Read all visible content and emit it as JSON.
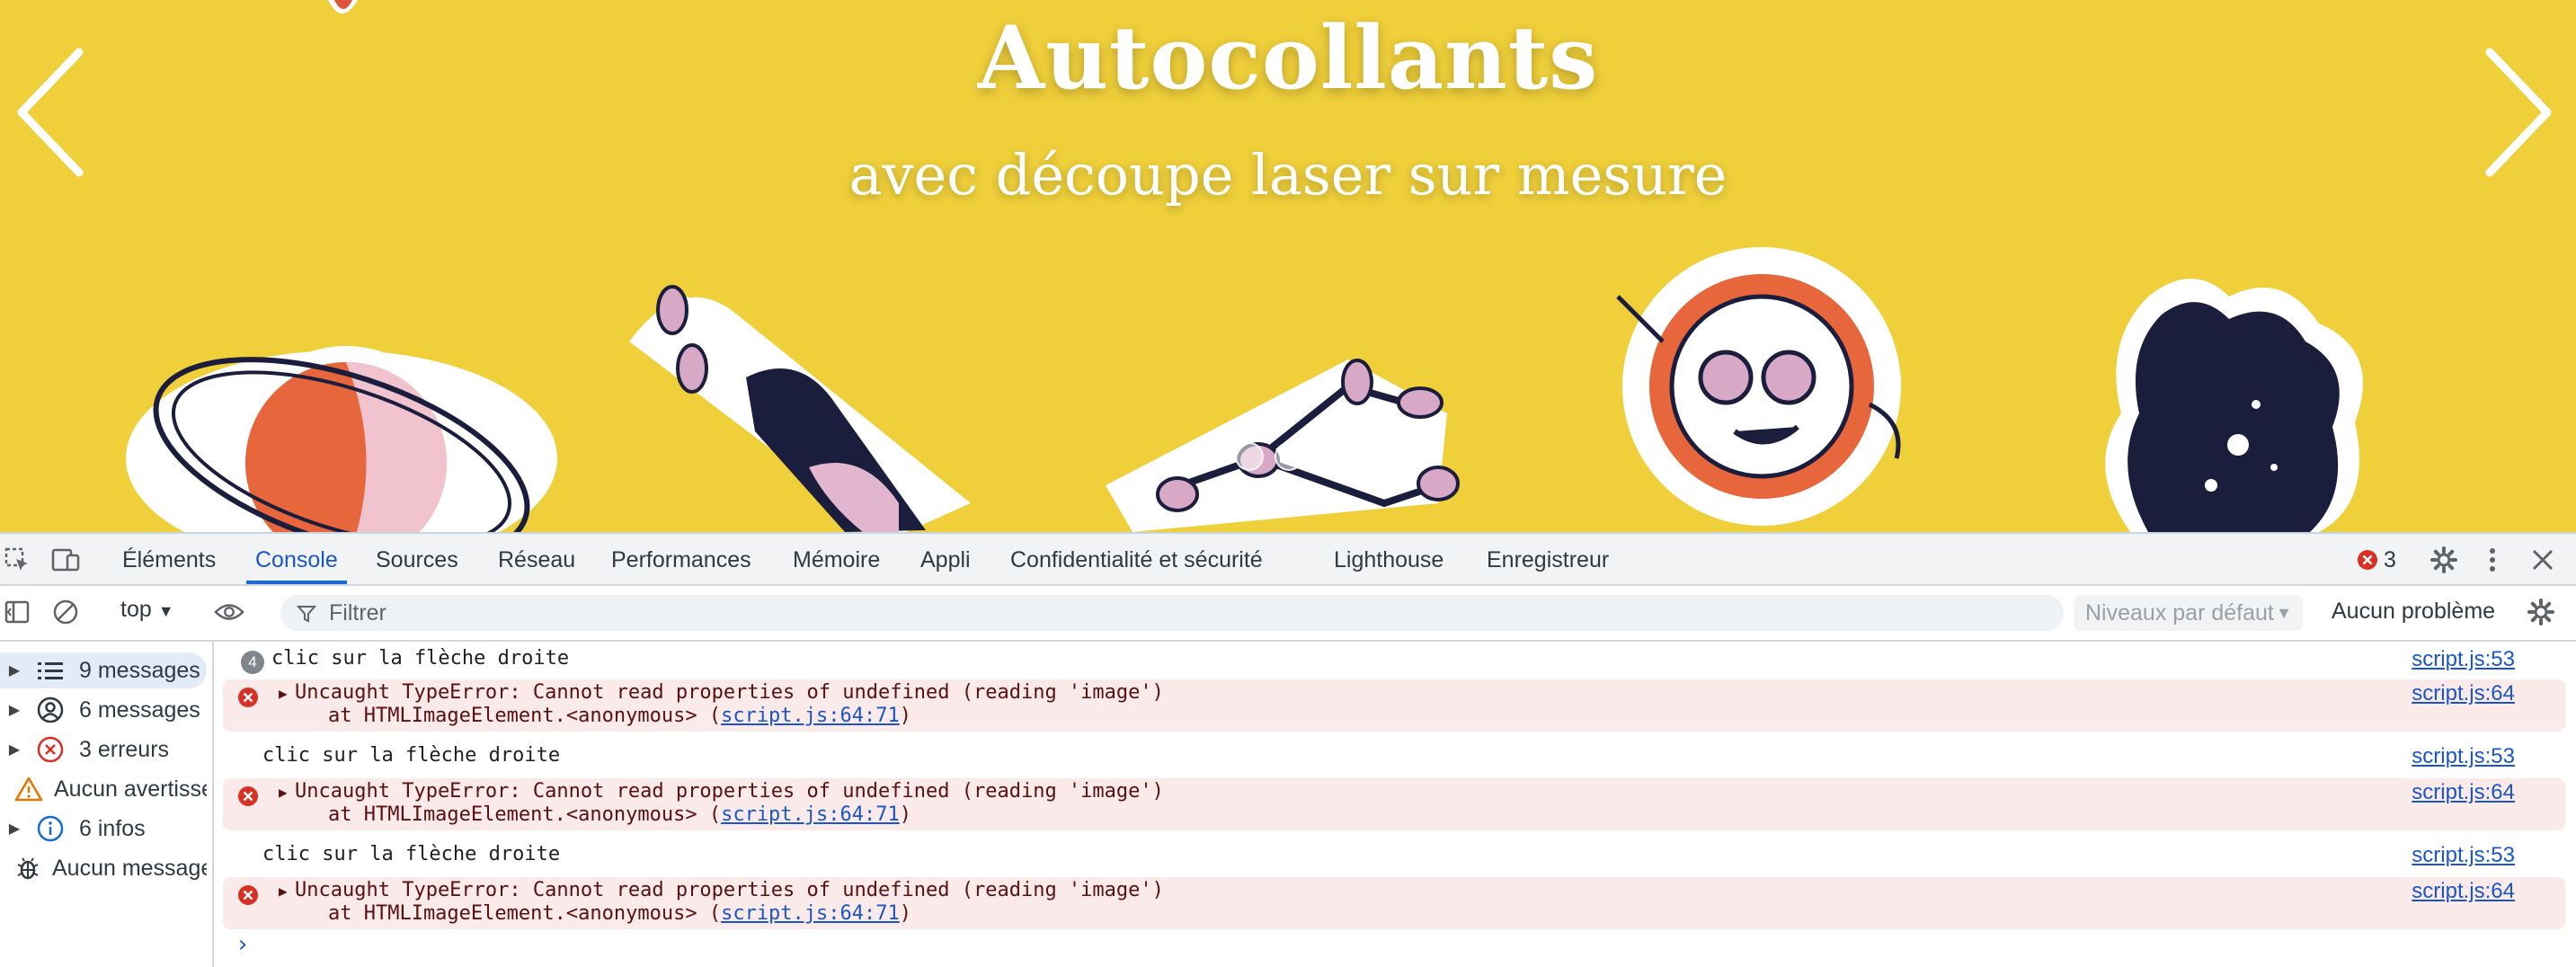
{
  "banner": {
    "title": "Autocollants",
    "subtitle": "avec découpe laser sur mesure",
    "background": "#efcf3a"
  },
  "tabs": [
    {
      "label": "Éléments"
    },
    {
      "label": "Console"
    },
    {
      "label": "Sources"
    },
    {
      "label": "Réseau"
    },
    {
      "label": "Performances"
    },
    {
      "label": "Mémoire"
    },
    {
      "label": "Appli"
    },
    {
      "label": "Confidentialité et sécurité"
    },
    {
      "label": "Lighthouse"
    },
    {
      "label": "Enregistreur"
    }
  ],
  "active_tab": "Console",
  "error_count": "3",
  "toolbar": {
    "context": "top",
    "filter_placeholder": "Filtrer",
    "levels": "Niveaux par défaut",
    "issues": "Aucun problème"
  },
  "sidebar": [
    {
      "label": "9 messages",
      "icon": "list-icon"
    },
    {
      "label": "6 messages",
      "icon": "user-icon"
    },
    {
      "label": "3 erreurs",
      "icon": "error-icon"
    },
    {
      "label": "Aucun avertissement",
      "icon": "warning-icon"
    },
    {
      "label": "6 infos",
      "icon": "info-icon"
    },
    {
      "label": "Aucun message de débogage",
      "icon": "bug-icon"
    }
  ],
  "console": {
    "repeat_count": "4",
    "log_text": "clic sur la flèche droite",
    "log_source": "script.js:53",
    "error_text": "Uncaught TypeError: Cannot read properties of undefined (reading 'image')",
    "error_at": "    at HTMLImageElement.<anonymous> (",
    "error_link": "script.js:64:71",
    "error_close": ")",
    "error_source": "script.js:64"
  },
  "colors": {
    "accent": "#1a6bd6",
    "error_bg": "#fbeaea",
    "error_icon": "#d93025"
  }
}
